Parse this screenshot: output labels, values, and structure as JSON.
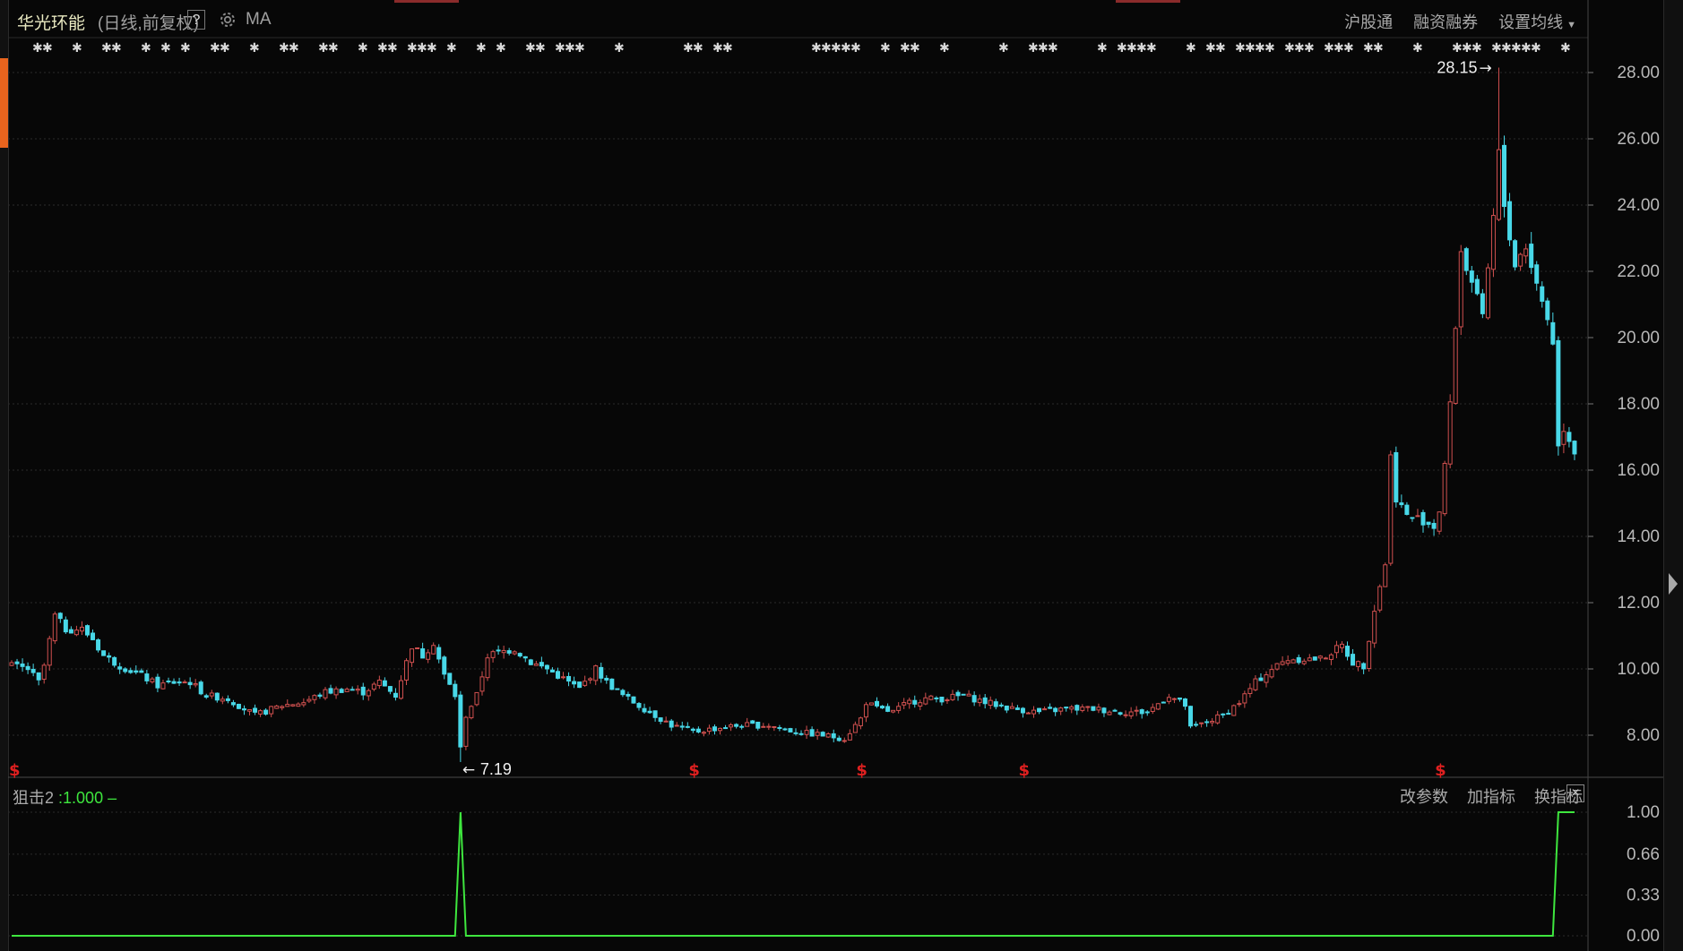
{
  "header": {
    "stock_name": "华光环能",
    "mode": "(日线,前复权)",
    "help": "?",
    "indicator": "MA",
    "links": [
      "沪股通",
      "融资融券",
      "设置均线"
    ]
  },
  "main_chart": {
    "y_ticks": [
      "28.00",
      "26.00",
      "24.00",
      "22.00",
      "20.00",
      "18.00",
      "16.00",
      "14.00",
      "12.00",
      "10.00",
      "8.00"
    ],
    "y_tick_values": [
      28,
      26,
      24,
      22,
      20,
      18,
      16,
      14,
      12,
      10,
      8
    ],
    "high_label": "28.15",
    "low_label": "7.19",
    "signal_marker": "$",
    "colors": {
      "up": "#d0504f",
      "down": "#48d8e8",
      "grid": "#2b2b2b"
    }
  },
  "sub_chart": {
    "name": "狙击2",
    "value_text": ":1.000",
    "buttons": [
      "改参数",
      "加指标",
      "换指标"
    ],
    "close": "×",
    "y_ticks": [
      "1.00",
      "0.66",
      "0.33",
      "0.00"
    ],
    "y_tick_values": [
      1,
      0.66,
      0.33,
      0
    ],
    "line_color": "#3ee63e"
  },
  "chart_data": {
    "type": "candlestick",
    "title": "华光环能",
    "ylim": [
      7.19,
      28.15
    ],
    "price_path": [
      [
        0,
        10.1
      ],
      [
        3,
        10.0
      ],
      [
        5,
        9.6
      ],
      [
        6,
        10.1
      ],
      [
        8,
        11.6
      ],
      [
        10,
        11.2
      ],
      [
        13,
        11.2
      ],
      [
        15,
        10.9
      ],
      [
        17,
        10.4
      ],
      [
        20,
        10.1
      ],
      [
        24,
        9.8
      ],
      [
        27,
        9.5
      ],
      [
        30,
        9.6
      ],
      [
        33,
        9.6
      ],
      [
        36,
        9.2
      ],
      [
        40,
        9.1
      ],
      [
        45,
        8.6
      ],
      [
        50,
        8.9
      ],
      [
        54,
        9.0
      ],
      [
        58,
        9.3
      ],
      [
        62,
        9.4
      ],
      [
        65,
        9.3
      ],
      [
        68,
        9.6
      ],
      [
        71,
        9.2
      ],
      [
        74,
        10.7
      ],
      [
        76,
        10.4
      ],
      [
        78,
        10.8
      ],
      [
        80,
        9.8
      ],
      [
        82,
        9.2
      ],
      [
        83,
        7.6
      ],
      [
        84,
        8.6
      ],
      [
        86,
        9.2
      ],
      [
        88,
        10.4
      ],
      [
        90,
        10.5
      ],
      [
        93,
        10.6
      ],
      [
        96,
        10.2
      ],
      [
        99,
        10.0
      ],
      [
        102,
        9.7
      ],
      [
        105,
        9.4
      ],
      [
        108,
        10.0
      ],
      [
        110,
        9.6
      ],
      [
        113,
        9.2
      ],
      [
        116,
        8.9
      ],
      [
        119,
        8.6
      ],
      [
        122,
        8.3
      ],
      [
        126,
        8.1
      ],
      [
        130,
        8.2
      ],
      [
        135,
        8.3
      ],
      [
        140,
        8.3
      ],
      [
        145,
        8.1
      ],
      [
        150,
        8.0
      ],
      [
        154,
        7.9
      ],
      [
        157,
        8.5
      ],
      [
        158,
        9.0
      ],
      [
        160,
        8.8
      ],
      [
        163,
        8.7
      ],
      [
        166,
        9.0
      ],
      [
        169,
        9.1
      ],
      [
        172,
        9.1
      ],
      [
        176,
        9.2
      ],
      [
        180,
        9.0
      ],
      [
        185,
        8.8
      ],
      [
        190,
        8.7
      ],
      [
        195,
        8.8
      ],
      [
        200,
        8.8
      ],
      [
        205,
        8.7
      ],
      [
        210,
        8.7
      ],
      [
        214,
        9.2
      ],
      [
        217,
        8.9
      ],
      [
        218,
        8.2
      ],
      [
        221,
        8.4
      ],
      [
        224,
        8.6
      ],
      [
        227,
        9.0
      ],
      [
        230,
        9.6
      ],
      [
        233,
        10.0
      ],
      [
        236,
        10.3
      ],
      [
        239,
        10.3
      ],
      [
        242,
        10.3
      ],
      [
        244,
        10.5
      ],
      [
        246,
        10.7
      ],
      [
        248,
        10.2
      ],
      [
        250,
        10.1
      ],
      [
        252,
        11.8
      ],
      [
        254,
        13.2
      ],
      [
        255,
        16.4
      ],
      [
        256,
        15.2
      ],
      [
        258,
        14.6
      ],
      [
        261,
        14.5
      ],
      [
        263,
        14.3
      ],
      [
        264,
        14.8
      ],
      [
        265,
        16.2
      ],
      [
        266,
        17.9
      ],
      [
        267,
        20.4
      ],
      [
        268,
        22.6
      ],
      [
        270,
        21.7
      ],
      [
        272,
        20.5
      ],
      [
        274,
        23.6
      ],
      [
        275,
        25.5
      ],
      [
        276,
        24.0
      ],
      [
        278,
        22.2
      ],
      [
        280,
        22.8
      ],
      [
        282,
        21.6
      ],
      [
        284,
        20.6
      ],
      [
        285,
        19.9
      ],
      [
        286,
        16.7
      ],
      [
        287,
        17.3
      ],
      [
        289,
        16.6
      ]
    ],
    "high": {
      "value": 28.15,
      "bar": 275
    },
    "low": {
      "value": 7.19,
      "bar": 83
    },
    "signal_bars": [
      0,
      126,
      157,
      187,
      264
    ],
    "sub_series": {
      "name": "狙击2",
      "spikes": [
        {
          "bar": 83,
          "value": 1
        },
        {
          "bar": 286,
          "value": 1
        }
      ],
      "current": 1.0
    }
  }
}
